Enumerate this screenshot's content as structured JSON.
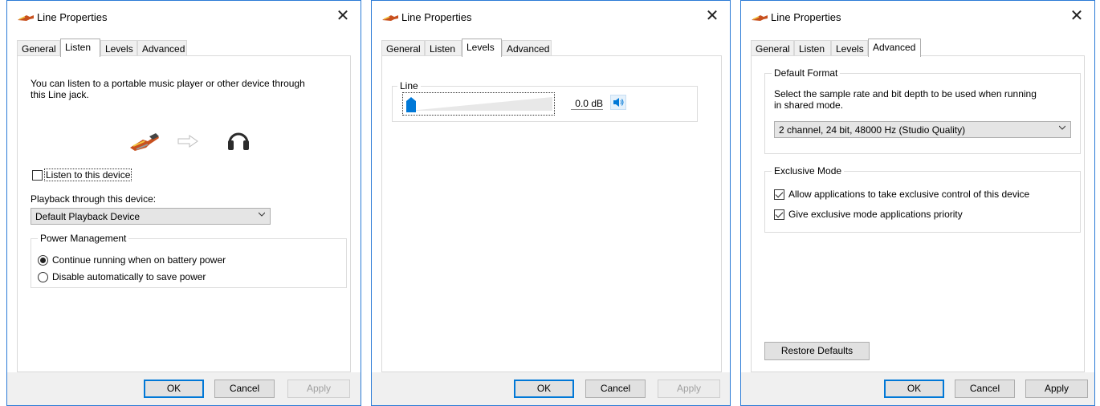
{
  "dialogs": [
    {
      "title": "Line Properties",
      "tabs": [
        "General",
        "Listen",
        "Levels",
        "Advanced"
      ],
      "active_tab": "Listen",
      "description": [
        "You can listen to a portable music player or other device through",
        "this Line jack."
      ],
      "listen_checkbox": {
        "label": "Listen to this device",
        "checked": false
      },
      "playback_label": "Playback through this device:",
      "playback_select": "Default Playback Device",
      "power_group": {
        "title": "Power Management",
        "options": [
          {
            "label": "Continue running when on battery power",
            "selected": true
          },
          {
            "label": "Disable automatically to save power",
            "selected": false
          }
        ]
      },
      "buttons": {
        "ok": "OK",
        "cancel": "Cancel",
        "apply": "Apply",
        "apply_enabled": false
      }
    },
    {
      "title": "Line Properties",
      "tabs": [
        "General",
        "Listen",
        "Levels",
        "Advanced"
      ],
      "active_tab": "Levels",
      "line_group": {
        "title": "Line",
        "level_value": "0.0 dB",
        "level_fraction": 0.0,
        "muted": false
      },
      "buttons": {
        "ok": "OK",
        "cancel": "Cancel",
        "apply": "Apply",
        "apply_enabled": false
      }
    },
    {
      "title": "Line Properties",
      "tabs": [
        "General",
        "Listen",
        "Levels",
        "Advanced"
      ],
      "active_tab": "Advanced",
      "default_format": {
        "title": "Default Format",
        "description": [
          "Select the sample rate and bit depth to be used when running",
          "in shared mode."
        ],
        "select_value": "2 channel, 24 bit, 48000 Hz (Studio Quality)"
      },
      "exclusive_mode": {
        "title": "Exclusive Mode",
        "options": [
          {
            "label": "Allow applications to take exclusive control of this device",
            "checked": true
          },
          {
            "label": "Give exclusive mode applications priority",
            "checked": true
          }
        ]
      },
      "restore_defaults": "Restore Defaults",
      "buttons": {
        "ok": "OK",
        "cancel": "Cancel",
        "apply": "Apply",
        "apply_enabled": true
      }
    }
  ],
  "icons": {
    "title_icon": "line-jack-icon",
    "close_icon": "close-icon",
    "jack_icon": "rca-plug-icon",
    "arrow_icon": "arrow-right-icon",
    "headphones_icon": "headphones-icon",
    "speaker_icon": "speaker-icon",
    "dropdown_icon": "chevron-down-icon"
  },
  "colors": {
    "accent": "#0078d7",
    "window_border": "#2b7bd6",
    "footer_bg": "#f0f0f0",
    "button_bg": "#e1e1e1"
  }
}
